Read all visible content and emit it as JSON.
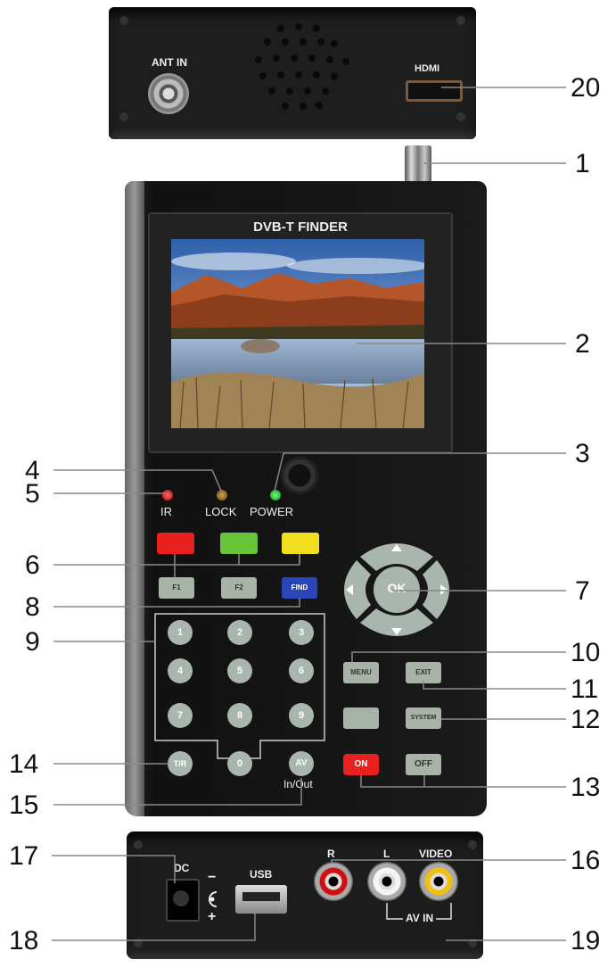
{
  "screen_title": "DVB-T FINDER",
  "top_panel": {
    "ant_in": "ANT IN",
    "hdmi": "HDMI"
  },
  "indicators": {
    "ir": "IR",
    "lock": "LOCK",
    "power": "POWER"
  },
  "function_keys": {
    "f1": "F1",
    "f2": "F2",
    "find": "FIND"
  },
  "numpad": [
    "1",
    "2",
    "3",
    "4",
    "5",
    "6",
    "7",
    "8",
    "9",
    "0"
  ],
  "side_keys": {
    "tr": "T/R",
    "av": "AV",
    "in_out": "In/Out"
  },
  "nav": {
    "ok": "OK"
  },
  "control_keys": {
    "menu": "MENU",
    "exit": "EXIT",
    "system": "SYSTEM",
    "on": "ON",
    "off": "OFF"
  },
  "bottom_panel": {
    "dc": "DC",
    "usb": "USB",
    "r": "R",
    "l": "L",
    "video": "VIDEO",
    "av_in": "AV IN",
    "minus": "−",
    "plus": "+"
  },
  "callouts": {
    "n1": "1",
    "n2": "2",
    "n3": "3",
    "n4": "4",
    "n5": "5",
    "n6": "6",
    "n7": "7",
    "n8": "8",
    "n9": "9",
    "n10": "10",
    "n11": "11",
    "n12": "12",
    "n13": "13",
    "n14": "14",
    "n15": "15",
    "n16": "16",
    "n17": "17",
    "n18": "18",
    "n19": "19",
    "n20": "20"
  }
}
